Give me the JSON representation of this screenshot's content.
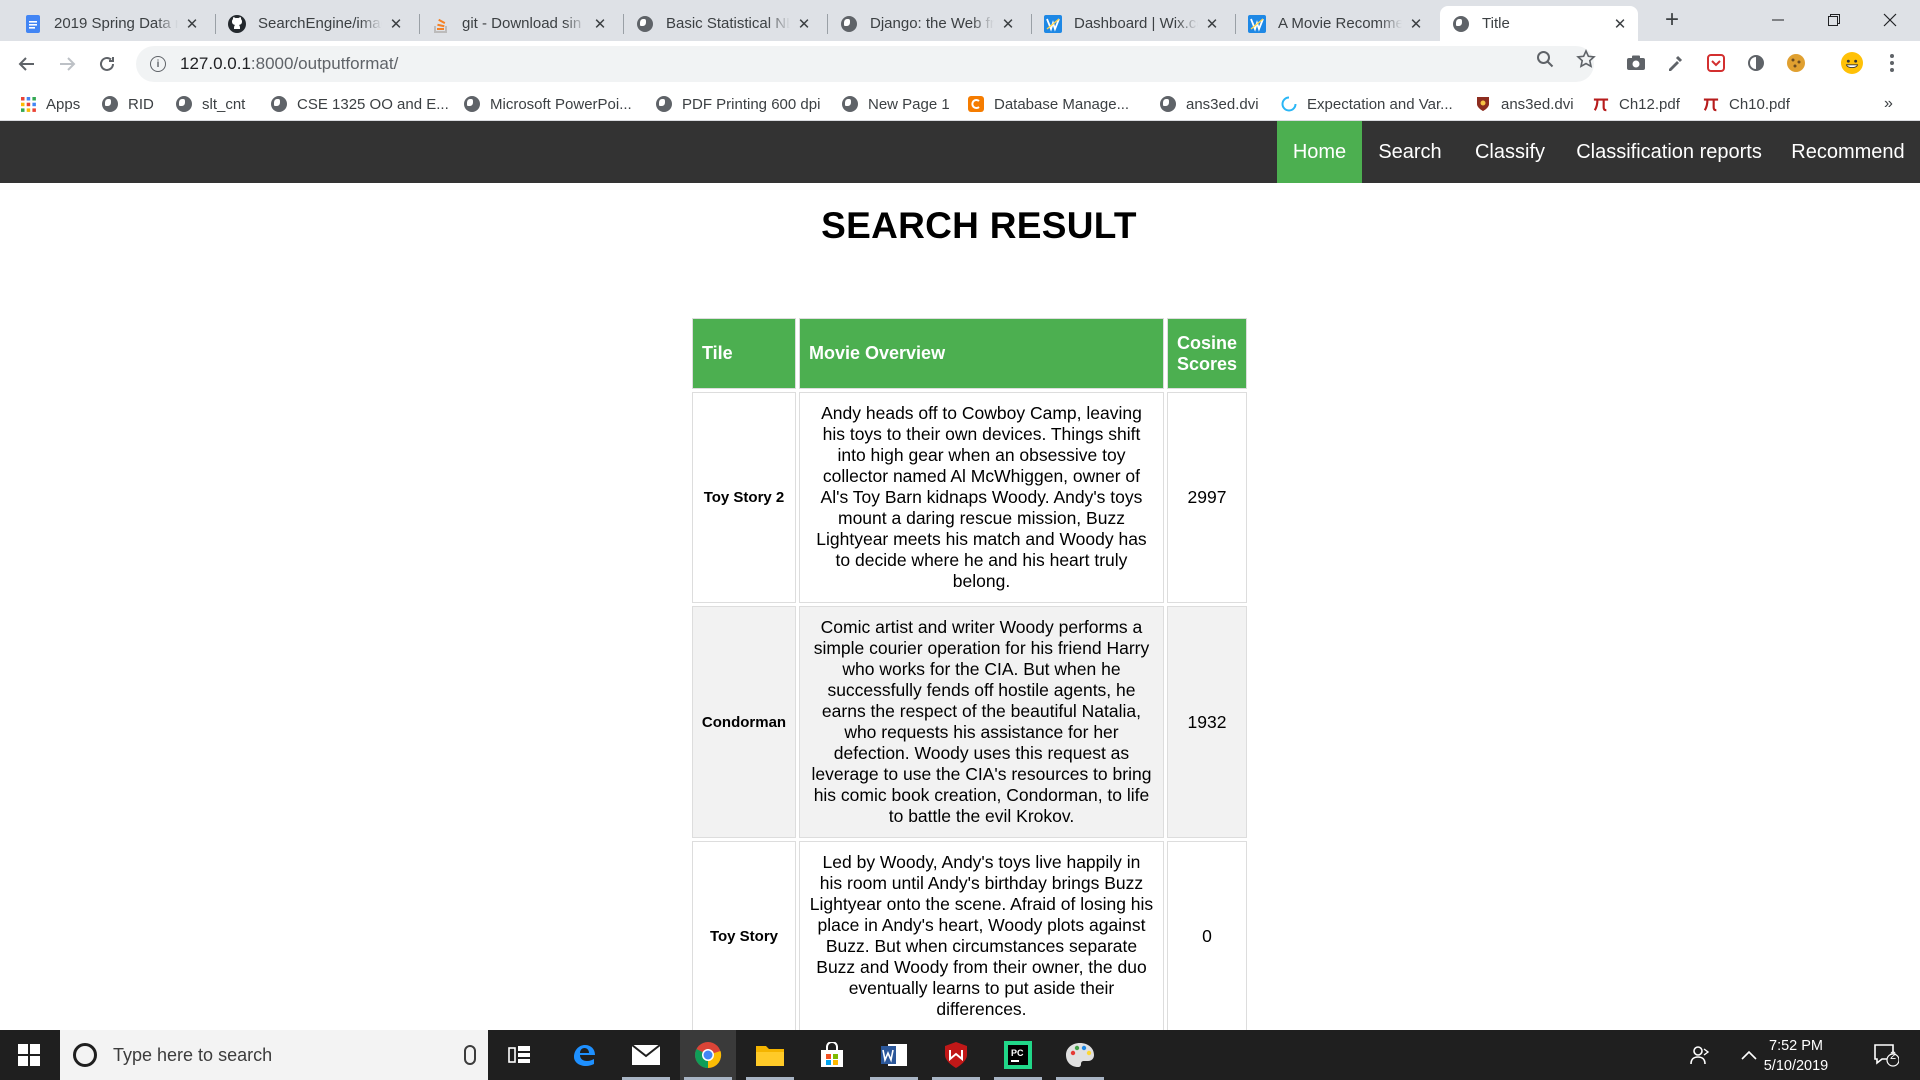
{
  "browser": {
    "tabs": [
      {
        "label": "2019 Spring Data m",
        "icon": "docs-icon"
      },
      {
        "label": "SearchEngine/imag",
        "icon": "github-icon"
      },
      {
        "label": "git - Download sin",
        "icon": "stackoverflow-icon"
      },
      {
        "label": "Basic Statistical NL",
        "icon": "globe-icon"
      },
      {
        "label": "Django: the Web fr",
        "icon": "globe-icon"
      },
      {
        "label": "Dashboard | Wix.co",
        "icon": "wix-icon"
      },
      {
        "label": "A Movie Recomme",
        "icon": "wix-icon"
      },
      {
        "label": "Title",
        "icon": "globe-icon",
        "active": true
      }
    ],
    "url_host": "127.0.0.1",
    "url_rest": ":8000/outputformat/",
    "bookmarks": [
      {
        "label": "Apps",
        "icon": "apps-grid-icon"
      },
      {
        "label": "RID",
        "icon": "globe-icon"
      },
      {
        "label": "slt_cnt",
        "icon": "globe-icon"
      },
      {
        "label": "CSE 1325 OO and E...",
        "icon": "globe-icon"
      },
      {
        "label": "Microsoft PowerPoi...",
        "icon": "globe-icon"
      },
      {
        "label": "PDF Printing 600 dpi",
        "icon": "globe-icon"
      },
      {
        "label": "New Page 1",
        "icon": "globe-icon"
      },
      {
        "label": "Database Manage...",
        "icon": "orange-c-icon"
      },
      {
        "label": "ans3ed.dvi",
        "icon": "globe-icon"
      },
      {
        "label": "Expectation and Var...",
        "icon": "loading-icon"
      },
      {
        "label": "ans3ed.dvi",
        "icon": "crest-icon"
      },
      {
        "label": "Ch12.pdf",
        "icon": "pi-icon"
      },
      {
        "label": "Ch10.pdf",
        "icon": "pi-icon"
      }
    ]
  },
  "nav": {
    "items": [
      "Home",
      "Search",
      "Classify",
      "Classification reports",
      "Recommend"
    ],
    "active": "Home",
    "active_color": "#4caf50",
    "background": "#333333"
  },
  "page": {
    "title": "SEARCH RESULT"
  },
  "table": {
    "headers": {
      "title": "Tile",
      "overview": "Movie Overview",
      "score": "Cosine Scores"
    },
    "header_color": "#4caf50",
    "rows": [
      {
        "title": "Toy Story 2",
        "overview": "Andy heads off to Cowboy Camp, leaving his toys to their own devices. Things shift into high gear when an obsessive toy collector named Al McWhiggen, owner of Al's Toy Barn kidnaps Woody. Andy's toys mount a daring rescue mission, Buzz Lightyear meets his match and Woody has to decide where he and his heart truly belong.",
        "score": "2997"
      },
      {
        "title": "Condorman",
        "overview": "Comic artist and writer Woody performs a simple courier operation for his friend Harry who works for the CIA. But when he successfully fends off hostile agents, he earns the respect of the beautiful Natalia, who requests his assistance for her defection. Woody uses this request as leverage to use the CIA's resources to bring his comic book creation, Condorman, to life to battle the evil Krokov.",
        "score": "1932"
      },
      {
        "title": "Toy Story",
        "overview": "Led by Woody, Andy's toys live happily in his room until Andy's birthday brings Buzz Lightyear onto the scene. Afraid of losing his place in Andy's heart, Woody plots against Buzz. But when circumstances separate Buzz and Woody from their owner, the duo eventually learns to put aside their differences.",
        "score": "0"
      }
    ]
  },
  "taskbar": {
    "search_placeholder": "Type here to search",
    "time": "7:52 PM",
    "date": "5/10/2019",
    "notification_count": "2"
  }
}
